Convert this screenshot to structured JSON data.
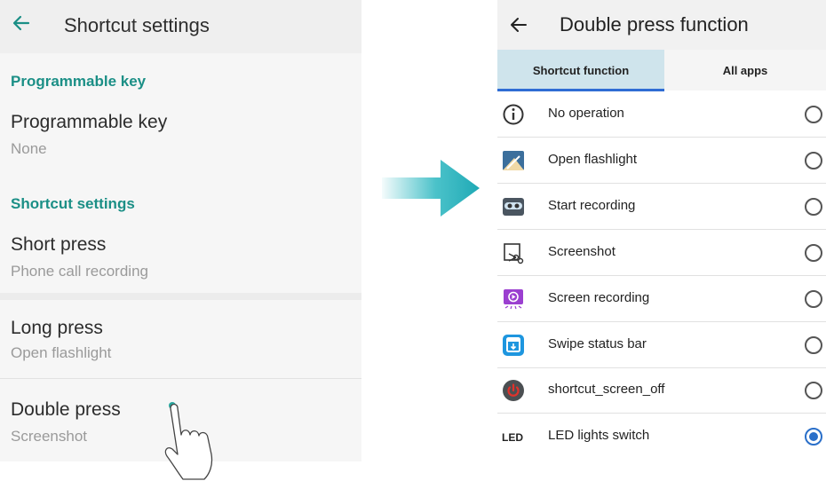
{
  "left": {
    "title": "Shortcut settings",
    "section1": "Programmable key",
    "programmable": {
      "label": "Programmable key",
      "value": "None"
    },
    "section2": "Shortcut settings",
    "short_press": {
      "label": "Short press",
      "value": "Phone call recording"
    },
    "long_press": {
      "label": "Long press",
      "value": "Open flashlight"
    },
    "double_press": {
      "label": "Double press",
      "value": "Screenshot"
    }
  },
  "right": {
    "title": "Double press function",
    "tabs": [
      "Shortcut function",
      "All apps"
    ],
    "selected_tab": 0,
    "options": [
      {
        "label": "No operation",
        "icon": "info-icon",
        "selected": false
      },
      {
        "label": "Open flashlight",
        "icon": "flashlight-icon",
        "selected": false
      },
      {
        "label": "Start recording",
        "icon": "recorder-icon",
        "selected": false
      },
      {
        "label": "Screenshot",
        "icon": "screenshot-icon",
        "selected": false
      },
      {
        "label": "Screen recording",
        "icon": "screen-recording-icon",
        "selected": false
      },
      {
        "label": "Swipe status bar",
        "icon": "status-bar-icon",
        "selected": false
      },
      {
        "label": "shortcut_screen_off",
        "icon": "power-icon",
        "selected": false
      },
      {
        "label": "LED lights switch",
        "icon": "led-icon",
        "icon_text": "LED",
        "selected": true
      }
    ]
  },
  "colors": {
    "accent": "#1b8f86",
    "arrow": "#2bb7c0",
    "radio_selected": "#2a6fc9",
    "tab_active": "#cfe4ec"
  }
}
